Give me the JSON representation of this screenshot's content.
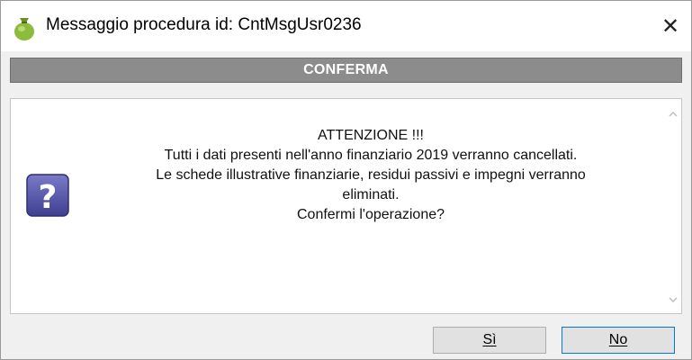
{
  "window": {
    "title": "Messaggio procedura id: CntMsgUsr0236",
    "close_symbol": "✕"
  },
  "banner": {
    "text": "CONFERMA"
  },
  "message": {
    "lines": [
      "ATTENZIONE !!!",
      "Tutti i dati presenti nell'anno finanziario 2019 verranno cancellati.",
      "Le schede illustrative finanziarie, residui passivi e impegni verranno",
      "eliminati.",
      "Confermi l'operazione?"
    ]
  },
  "icons": {
    "app": "money-bag-icon",
    "question": "question-mark-icon",
    "scroll_up": "chevron-up-icon",
    "scroll_down": "chevron-down-icon"
  },
  "buttons": {
    "yes_label": "Sì",
    "no_label": "No"
  },
  "colors": {
    "banner_bg": "#8c8c8c",
    "question_icon": "#5a5aa8",
    "focus_border": "#0078d7"
  }
}
